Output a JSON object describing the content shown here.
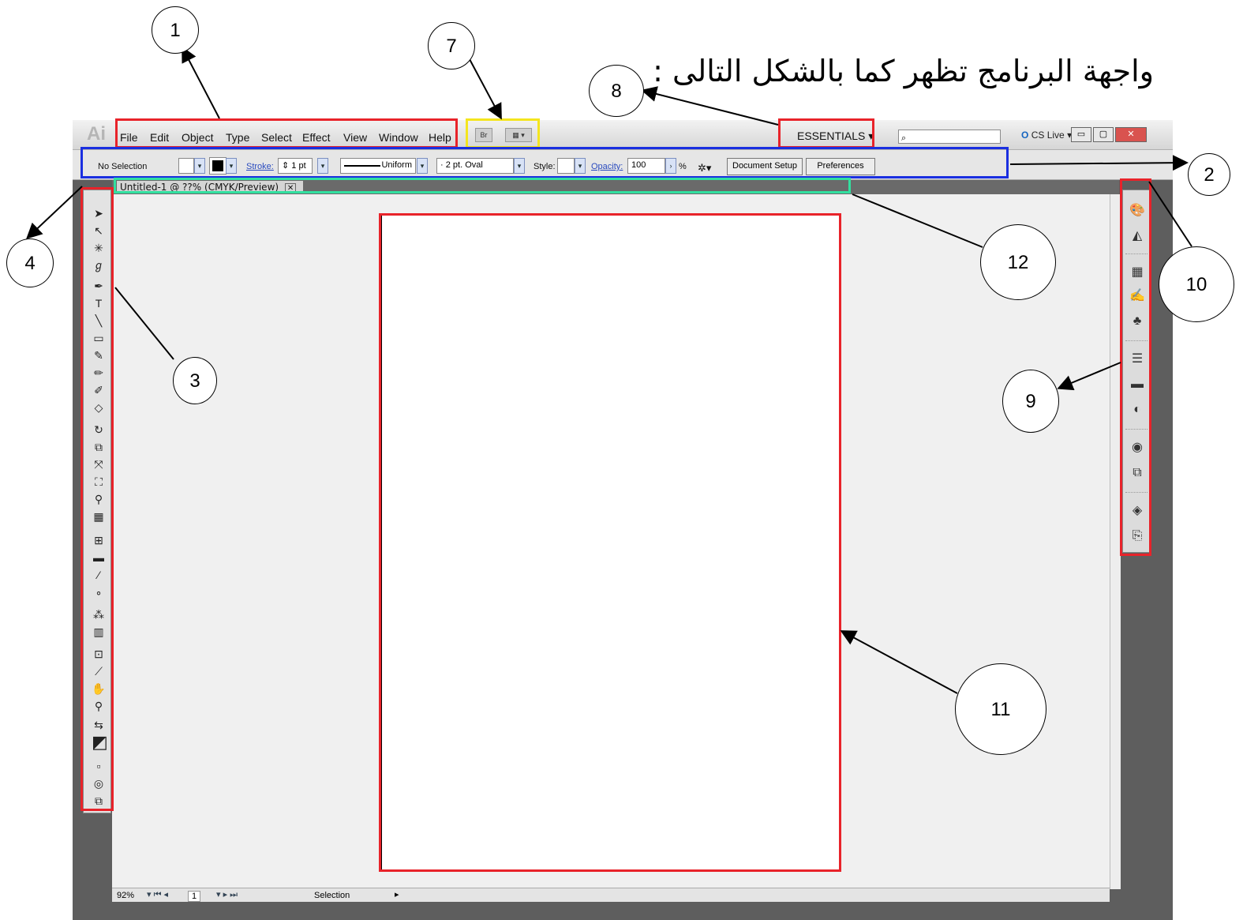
{
  "heading": "واجهة البرنامج تظهر كما بالشكل التالى :",
  "app": {
    "logo": "Ai",
    "menu": [
      "File",
      "Edit",
      "Object",
      "Type",
      "Select",
      "Effect",
      "View",
      "Window",
      "Help"
    ],
    "bridge_button": "Br",
    "workspace": "ESSENTIALS",
    "cs_live": "CS Live",
    "control_bar": {
      "selection": "No Selection",
      "stroke_label": "Stroke:",
      "stroke_value": "1 pt",
      "profile": "Uniform",
      "brush": "2 pt. Oval",
      "style_label": "Style:",
      "opacity_label": "Opacity:",
      "opacity_value": "100",
      "percent": "%",
      "document_setup": "Document Setup",
      "preferences": "Preferences"
    },
    "document_tab": "Untitled-1 @ ??% (CMYK/Preview)",
    "status_bar": {
      "zoom": "92%",
      "page": "1",
      "tool": "Selection"
    }
  },
  "annotations": [
    "1",
    "2",
    "3",
    "4",
    "7",
    "8",
    "9",
    "10",
    "11",
    "12"
  ],
  "colors": {
    "red_box": "#e8232a",
    "yellow_box": "#f4e51e",
    "blue_box": "#1a2fe0",
    "green_box": "#32e0a0"
  }
}
